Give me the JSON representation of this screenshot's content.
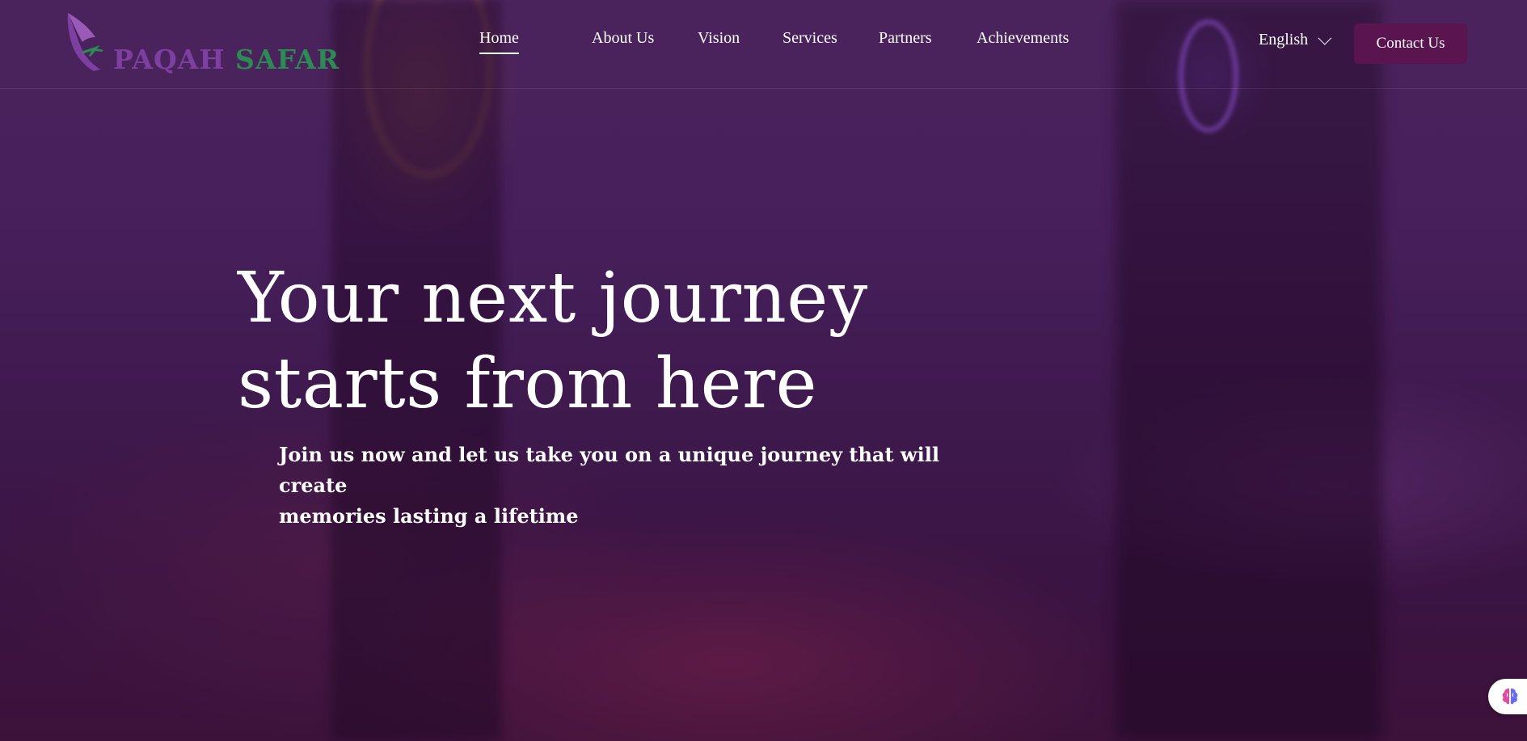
{
  "brand": {
    "logo_part1": "PAQAH ",
    "logo_part2": "SAFAR",
    "colors": {
      "purple": "#7d3fa0",
      "green": "#2c8a55"
    }
  },
  "nav": {
    "items": [
      {
        "label": "Home",
        "active": true
      },
      {
        "label": "About Us"
      },
      {
        "label": "Vision"
      },
      {
        "label": "Services"
      },
      {
        "label": "Partners"
      },
      {
        "label": "Achievements"
      }
    ]
  },
  "header": {
    "language": "English",
    "contact_label": "Contact Us",
    "contact_color": "#5a1450"
  },
  "hero": {
    "title_line1": "Your next journey",
    "title_line2": "starts from here",
    "subtitle_line1": "Join us now and let us take you on a unique journey that will create",
    "subtitle_line2": "memories lasting a lifetime"
  },
  "widgets": {
    "assistant_icon": "brain-icon"
  }
}
